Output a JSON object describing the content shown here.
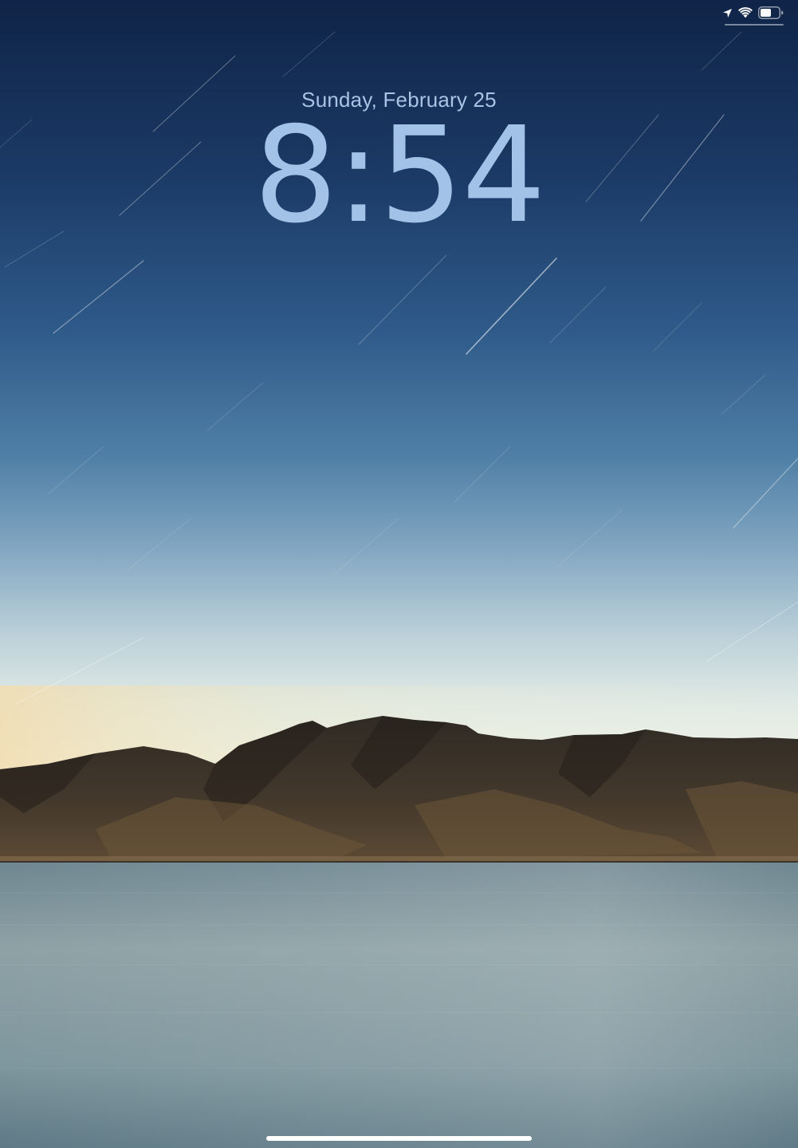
{
  "lock_screen": {
    "date": "Sunday, February 25",
    "time": "8:54"
  },
  "status_bar": {
    "icons": [
      "location-arrow-icon",
      "wifi-icon",
      "battery-icon"
    ],
    "battery_level": 0.6
  },
  "colors": {
    "sky_top": "#0f2447",
    "sky_mid": "#3e6c98",
    "horizon": "#e4ecd9",
    "mountains": "#3f3528",
    "water": "#8a9ea3",
    "clock_text": "#a2c2e8"
  }
}
